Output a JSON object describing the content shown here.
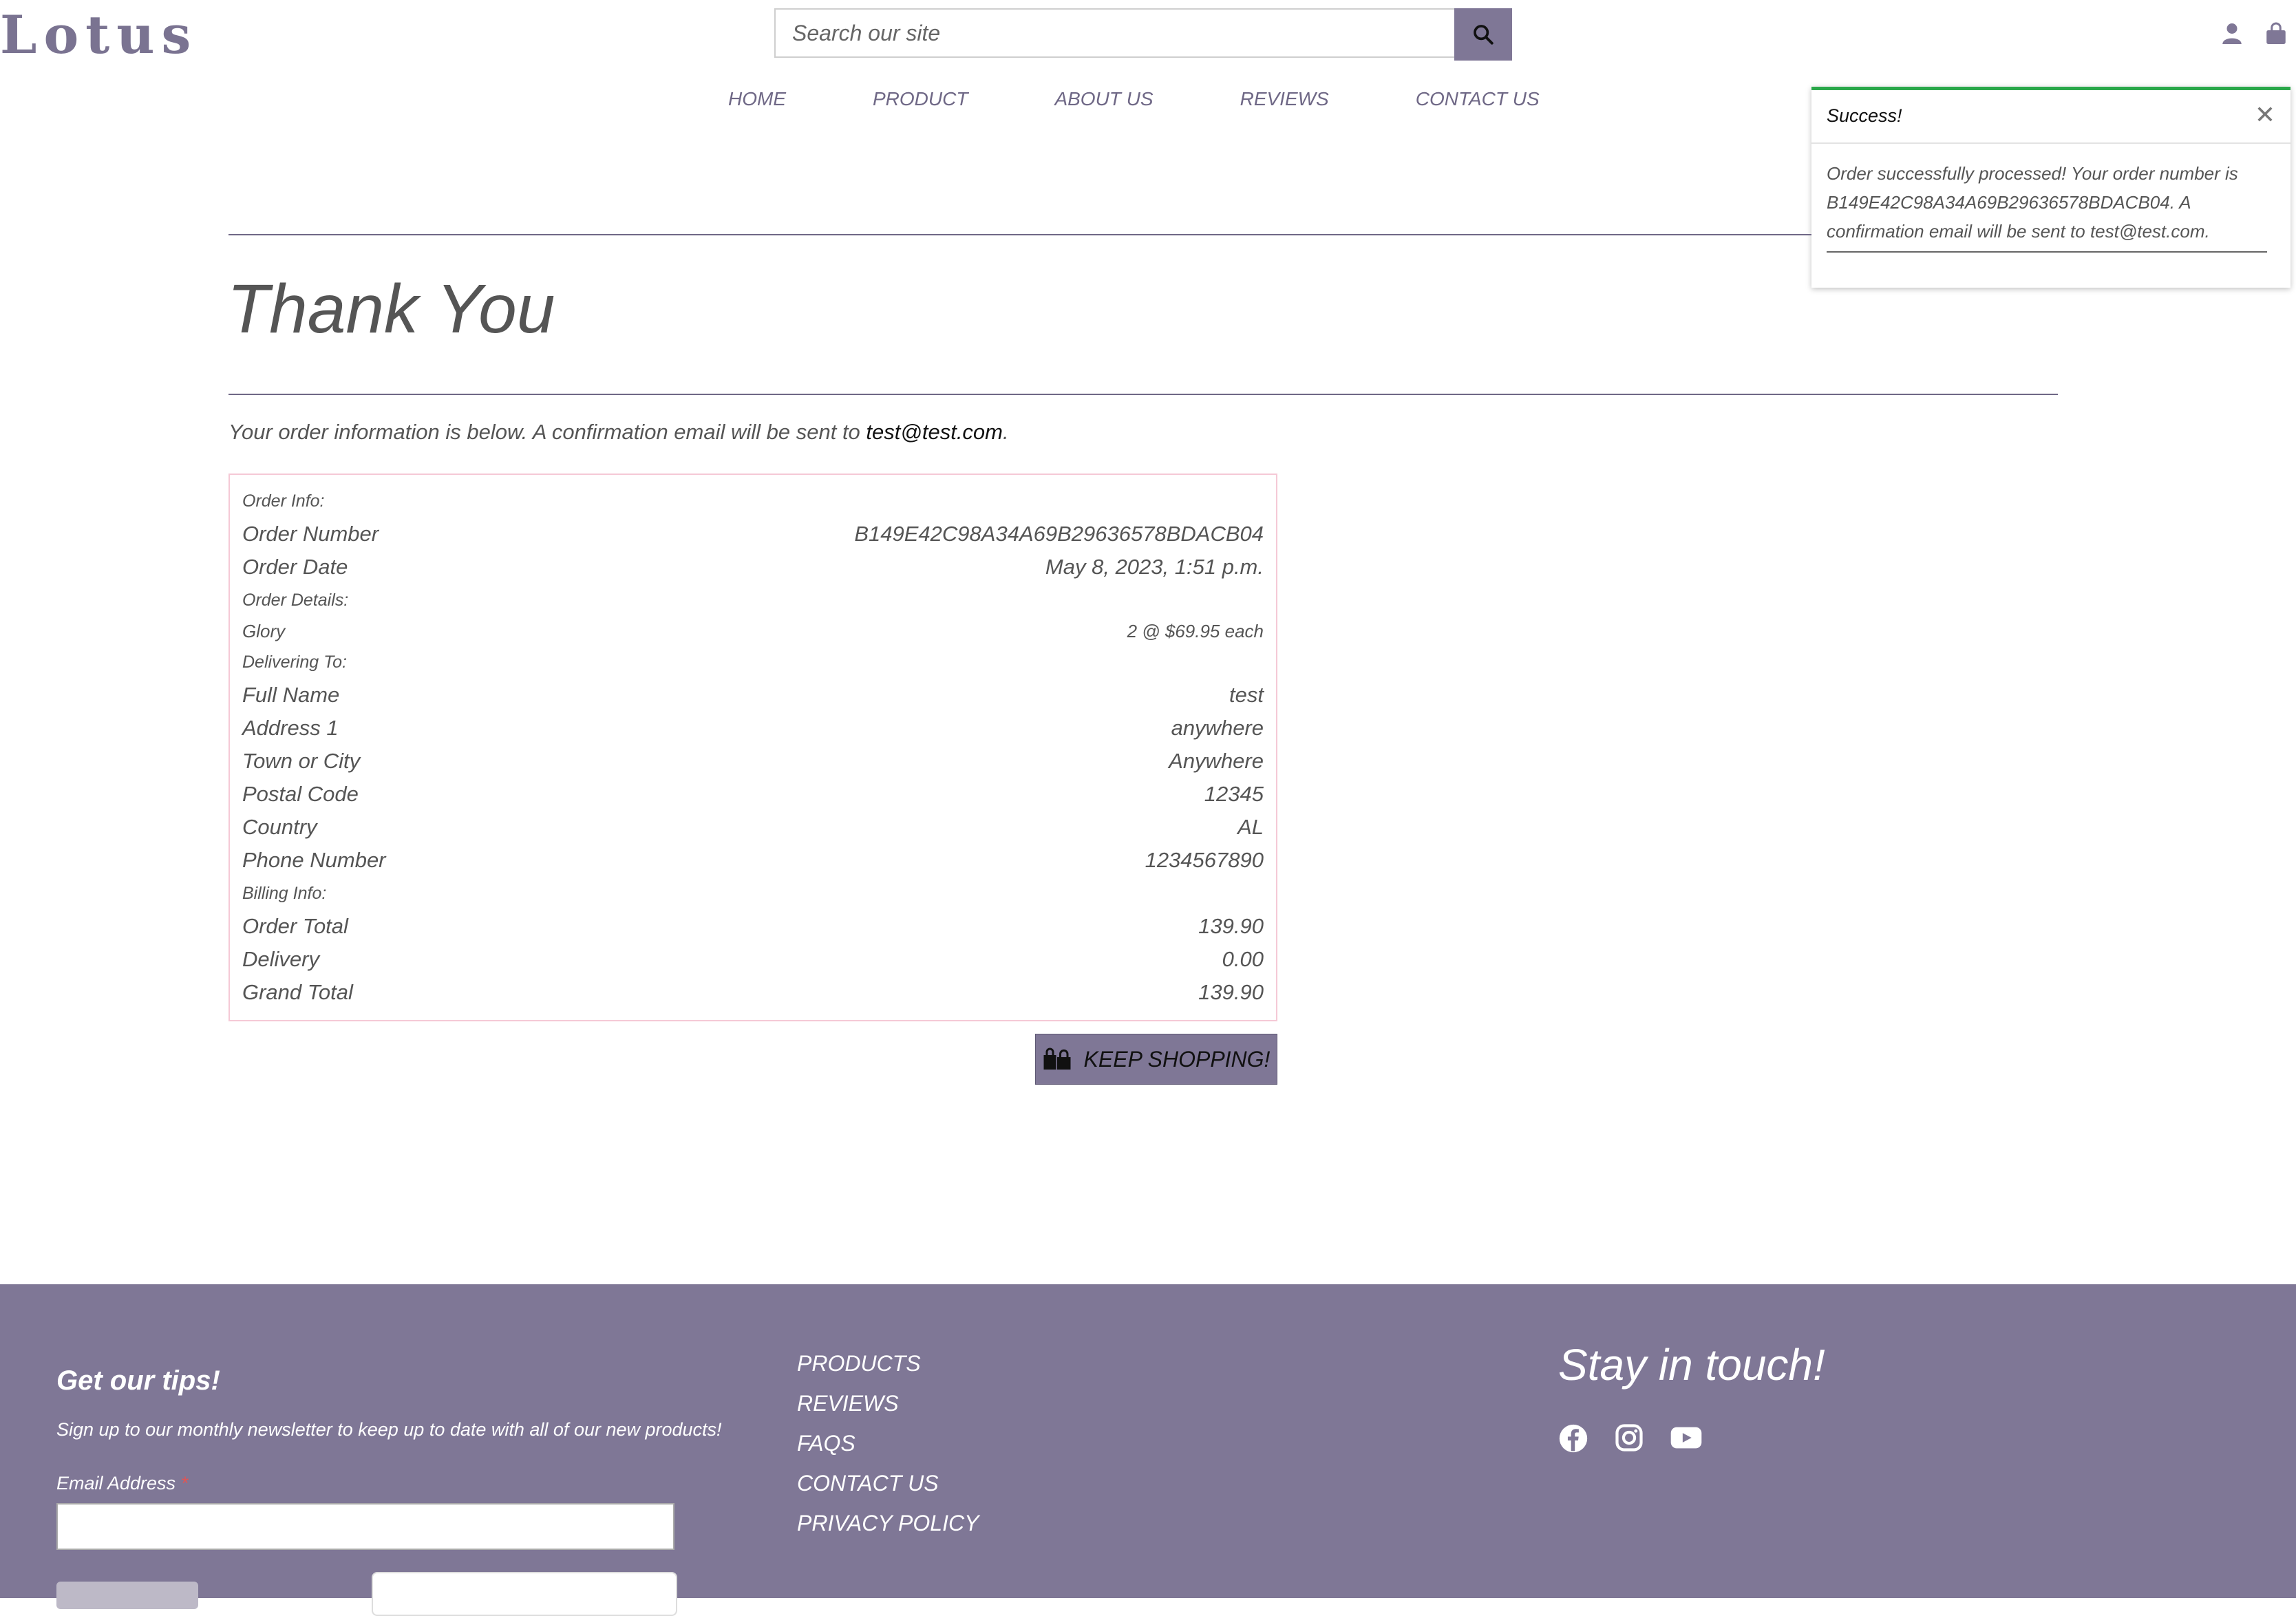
{
  "header": {
    "logo": "Lotus",
    "search_placeholder": "Search our site"
  },
  "nav": [
    "HOME",
    "PRODUCT",
    "ABOUT US",
    "REVIEWS",
    "CONTACT US"
  ],
  "toast": {
    "title": "Success!",
    "message": "Order successfully processed! Your order number is B149E42C98A34A69B29636578BDACB04. A confirmation email will be sent to test@test.com."
  },
  "main": {
    "title": "Thank You",
    "intro_prefix": "Your order information is below. A confirmation email will be sent to ",
    "intro_email": "test@test.com",
    "intro_suffix": ".",
    "order_info_label": "Order Info:",
    "order_number_label": "Order Number",
    "order_number": "B149E42C98A34A69B29636578BDACB04",
    "order_date_label": "Order Date",
    "order_date": "May 8, 2023, 1:51 p.m.",
    "order_details_label": "Order Details:",
    "item_name": "Glory",
    "item_qty": "2 @ $69.95 each",
    "delivering_label": "Delivering To:",
    "full_name_label": "Full Name",
    "full_name": "test",
    "address1_label": "Address 1",
    "address1": "anywhere",
    "town_label": "Town or City",
    "town": "Anywhere",
    "postal_label": "Postal Code",
    "postal": "12345",
    "country_label": "Country",
    "country": "AL",
    "phone_label": "Phone Number",
    "phone": "1234567890",
    "billing_label": "Billing Info:",
    "order_total_label": "Order Total",
    "order_total": "139.90",
    "delivery_label": "Delivery",
    "delivery": "0.00",
    "grand_total_label": "Grand Total",
    "grand_total": "139.90",
    "keep_shopping": "KEEP SHOPPING!"
  },
  "footer": {
    "tips_title": "Get our tips!",
    "signup_text": "Sign up to our monthly newsletter to keep up to date with all of our new products!",
    "email_label": "Email Address",
    "required_mark": "*",
    "links": [
      "PRODUCTS",
      "REVIEWS",
      "FAQS",
      "CONTACT US",
      "PRIVACY POLICY"
    ],
    "stay_title": "Stay in touch!"
  },
  "colors": {
    "brand": "#7f7796",
    "success": "#2aa84a",
    "box_border": "#f5c9d6"
  },
  "icons": [
    "search-icon",
    "user-icon",
    "bag-icon",
    "close-icon",
    "shopping-icon",
    "facebook-icon",
    "instagram-icon",
    "youtube-icon"
  ]
}
